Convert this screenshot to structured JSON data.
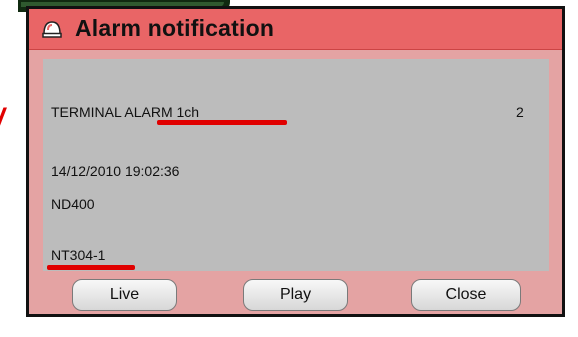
{
  "dialog": {
    "title": "Alarm notification",
    "title_icon": "alarm-bell-icon"
  },
  "alarm": {
    "terminal": "TERMINAL ALARM 1ch",
    "count": "2",
    "datetime": "14/12/2010 19:02:36",
    "device": "ND400",
    "camera": "NT304-1"
  },
  "buttons": {
    "live": "Live",
    "play": "Play",
    "close": "Close"
  },
  "colors": {
    "title_bar": "#e96566",
    "dialog_bg": "#e4a3a3",
    "content_bg": "#bcbcbc",
    "annotation": "#e00000"
  }
}
